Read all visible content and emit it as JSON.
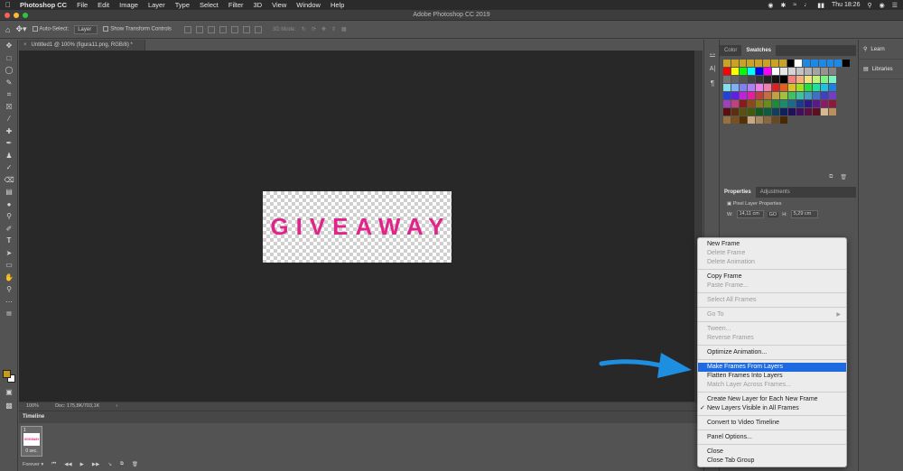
{
  "menubar": {
    "app": "Photoshop CC",
    "items": [
      "File",
      "Edit",
      "Image",
      "Layer",
      "Type",
      "Select",
      "Filter",
      "3D",
      "View",
      "Window",
      "Help"
    ],
    "clock": "Thu 18:26"
  },
  "window": {
    "title": "Adobe Photoshop CC 2019"
  },
  "options": {
    "auto_select_label": "Auto-Select:",
    "auto_select_value": "Layer",
    "transform_label": "Show Transform Controls",
    "mode_3d": "3D Mode:"
  },
  "document": {
    "tab_title": "Untitled1 @ 100% (figura11.png, RGB/8) *",
    "canvas_text": "GIVEAWAY"
  },
  "status": {
    "zoom": "100%",
    "doc_info": "Doc: 175,8K/703,1K"
  },
  "timeline": {
    "title": "Timeline",
    "frame_number": "1",
    "frame_delay": "0 sec.",
    "loop": "Forever"
  },
  "swatches_panel": {
    "tabs": [
      "Color",
      "Swatches"
    ],
    "active_tab": "Swatches",
    "rows": [
      [
        "#c9a227",
        "#c9a227",
        "#c9a227",
        "#c9a227",
        "#c9a227",
        "#c9a227",
        "#c9a227",
        "#c9a227",
        "#000000",
        "#ffffff",
        "#1e88e5",
        "#1e88e5",
        "#1e88e5",
        "#1e88e5",
        "#1e88e5",
        "#000000"
      ],
      [
        "#ff0000",
        "#ffff00",
        "#00ff00",
        "#00ffff",
        "#0000ff",
        "#ff00ff",
        "#ffffff",
        "#e6e6e6",
        "#d4d4d4",
        "#c4c4c4",
        "#b4b4b4",
        "#a4a4a4",
        "#949494",
        "#848484"
      ],
      [
        "#747474",
        "#646464",
        "#545454",
        "#444444",
        "#343434",
        "#242424",
        "#141414",
        "#000000",
        "#f08080",
        "#f0b080",
        "#f0e080",
        "#c0f080",
        "#80f080",
        "#80f0c0"
      ],
      [
        "#80e0f0",
        "#80b0f0",
        "#8080f0",
        "#b080f0",
        "#f080f0",
        "#f080b0",
        "#e02020",
        "#e06020",
        "#e0c020",
        "#a0e020",
        "#20e040",
        "#20e0a0",
        "#20c0e0",
        "#2080e0"
      ],
      [
        "#2040e0",
        "#6020e0",
        "#c020e0",
        "#e020a0",
        "#c04040",
        "#c07040",
        "#c0a040",
        "#a0c040",
        "#40c060",
        "#40c0a0",
        "#40a0c0",
        "#4070c0",
        "#4040c0",
        "#7040c0"
      ],
      [
        "#a040c0",
        "#c04080",
        "#8c1a1a",
        "#8c4a1a",
        "#8c7a1a",
        "#6a8c1a",
        "#1a8c3a",
        "#1a8c6a",
        "#1a6a8c",
        "#1a3a8c",
        "#2a1a8c",
        "#5a1a8c",
        "#8c1a6a",
        "#8c1a3a"
      ],
      [
        "#5a1010",
        "#5a3010",
        "#5a5010",
        "#405a10",
        "#105a20",
        "#105a40",
        "#10405a",
        "#10205a",
        "#20105a",
        "#40105a",
        "#5a1040",
        "#5a1020",
        "#d8b890",
        "#b89060"
      ],
      [
        "#987040",
        "#785020",
        "#583000",
        "#c8a880",
        "#a88860",
        "#886840",
        "#684820",
        "#482800"
      ]
    ]
  },
  "properties_panel": {
    "tabs": [
      "Properties",
      "Adjustments"
    ],
    "active_tab": "Properties",
    "section": "Pixel Layer Properties",
    "w_label": "W:",
    "w_value": "14,11 cm",
    "link_label": "GO",
    "h_label": "H:",
    "h_value": "5,29 cm"
  },
  "right_panels": {
    "learn": "Learn",
    "libraries": "Libraries"
  },
  "context_menu": {
    "groups": [
      [
        {
          "label": "New Frame",
          "enabled": true
        },
        {
          "label": "Delete Frame",
          "enabled": false
        },
        {
          "label": "Delete Animation",
          "enabled": false
        }
      ],
      [
        {
          "label": "Copy Frame",
          "enabled": true
        },
        {
          "label": "Paste Frame...",
          "enabled": false
        }
      ],
      [
        {
          "label": "Select All Frames",
          "enabled": false
        }
      ],
      [
        {
          "label": "Go To",
          "enabled": false,
          "submenu": true
        }
      ],
      [
        {
          "label": "Tween...",
          "enabled": false
        },
        {
          "label": "Reverse Frames",
          "enabled": false
        }
      ],
      [
        {
          "label": "Optimize Animation...",
          "enabled": true
        }
      ],
      [
        {
          "label": "Make Frames From Layers",
          "enabled": true,
          "selected": true
        },
        {
          "label": "Flatten Frames Into Layers",
          "enabled": true
        },
        {
          "label": "Match Layer Across Frames...",
          "enabled": false
        }
      ],
      [
        {
          "label": "Create New Layer for Each New Frame",
          "enabled": true
        },
        {
          "label": "New Layers Visible in All Frames",
          "enabled": true,
          "checked": true
        }
      ],
      [
        {
          "label": "Convert to Video Timeline",
          "enabled": true
        }
      ],
      [
        {
          "label": "Panel Options...",
          "enabled": true
        }
      ],
      [
        {
          "label": "Close",
          "enabled": true
        },
        {
          "label": "Close Tab Group",
          "enabled": true
        }
      ]
    ]
  },
  "colors": {
    "accent": "#1e6ae0",
    "text_pink": "#e0258a",
    "arrow": "#1e8fe0",
    "fg_swatch": "#c99a16"
  },
  "icons": [
    "apple-icon",
    "move-tool-icon",
    "home-icon",
    "search-icon",
    "wifi-icon",
    "battery-icon",
    "play-icon",
    "trash-icon"
  ]
}
